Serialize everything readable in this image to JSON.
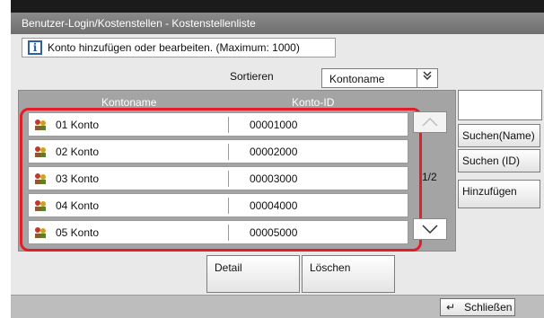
{
  "window": {
    "title": "Benutzer-Login/Kostenstellen - Kostenstellenliste"
  },
  "message": {
    "text": "Konto hinzufügen oder bearbeiten. (Maximum: 1000)",
    "icon": "info-icon"
  },
  "sort": {
    "label": "Sortieren",
    "value": "Kontoname"
  },
  "list": {
    "headers": {
      "name": "Kontoname",
      "id": "Konto-ID"
    },
    "rows": [
      {
        "name": "01  Konto",
        "id": "00001000"
      },
      {
        "name": "02  Konto",
        "id": "00002000"
      },
      {
        "name": "03  Konto",
        "id": "00003000"
      },
      {
        "name": "04  Konto",
        "id": "00004000"
      },
      {
        "name": "05  Konto",
        "id": "00005000"
      }
    ],
    "page": "1/2"
  },
  "side": {
    "search_name": "Suchen(Name)",
    "search_id": "Suchen (ID)",
    "add": "Hinzufügen"
  },
  "actions": {
    "detail": "Detail",
    "delete": "Löschen"
  },
  "footer": {
    "close": "Schließen"
  },
  "colors": {
    "highlight": "#e41e26",
    "titlebar": "#7a7a7a",
    "info": "#2c5fa8"
  }
}
